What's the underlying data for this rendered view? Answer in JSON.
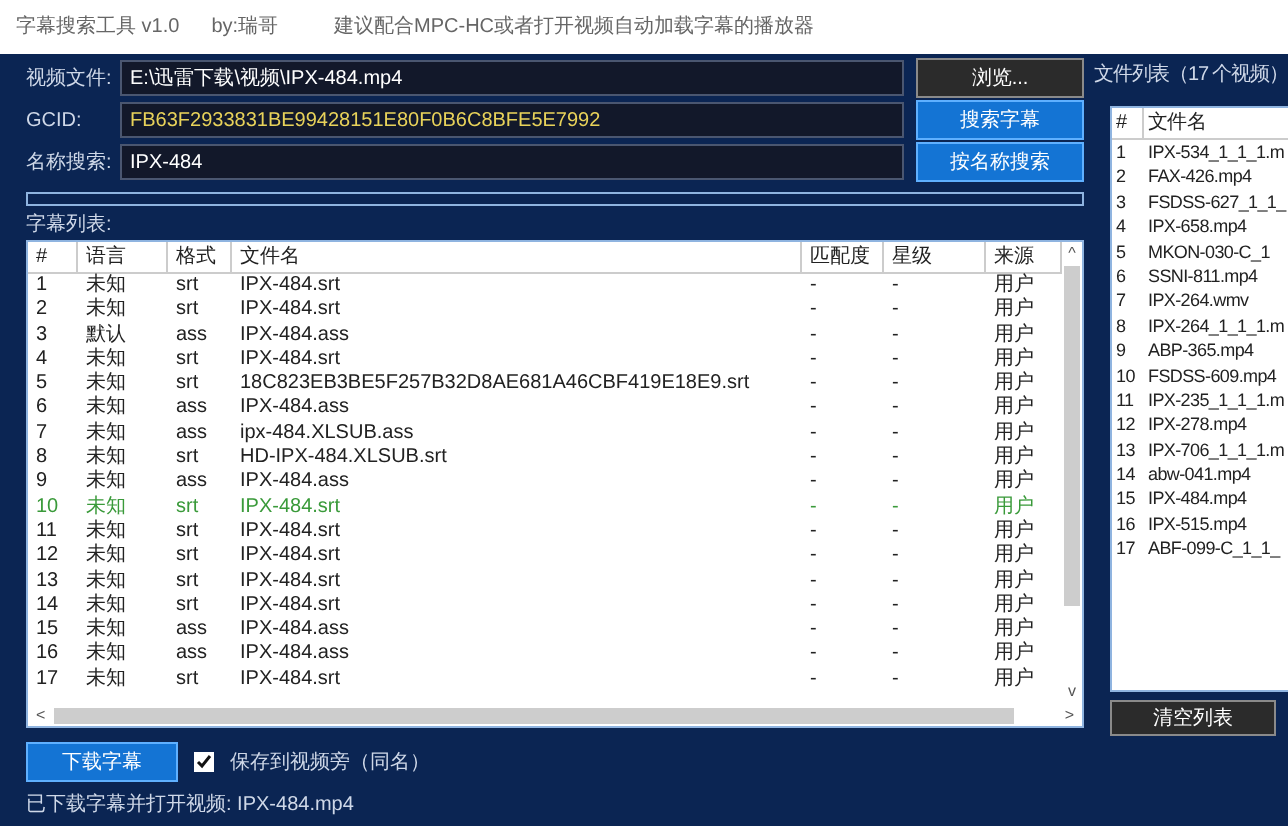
{
  "title_bar": {
    "app_name": "字幕搜索工具 v1.0",
    "author": "by:瑞哥",
    "tip": "建议配合MPC-HC或者打开视频自动加载字幕的播放器"
  },
  "form": [
    {
      "label": "视频文件:",
      "value": "E:\\迅雷下载\\视频\\IPX-484.mp4",
      "kind": "path",
      "button": "浏览..."
    },
    {
      "label": "GCID:",
      "value": "FB63F2933831BE99428151E80F0B6C8BFE5E7992",
      "kind": "hash",
      "button": "搜索字幕"
    },
    {
      "label": "名称搜索:",
      "value": "IPX-484",
      "kind": "name",
      "button": "按名称搜索"
    }
  ],
  "progress": {
    "level": 0
  },
  "subtitle_list": {
    "label": "字幕列表:",
    "columns": [
      "#",
      "语言",
      "格式",
      "文件名",
      "匹配度",
      "星级",
      "来源"
    ],
    "rows": [
      {
        "cells": [
          "1",
          "未知",
          "srt",
          "IPX-484.srt",
          "-",
          "-",
          "用户"
        ],
        "downloaded": false
      },
      {
        "cells": [
          "2",
          "未知",
          "srt",
          "IPX-484.srt",
          "-",
          "-",
          "用户"
        ],
        "downloaded": false
      },
      {
        "cells": [
          "3",
          "默认",
          "ass",
          "IPX-484.ass",
          "-",
          "-",
          "用户"
        ],
        "downloaded": false
      },
      {
        "cells": [
          "4",
          "未知",
          "srt",
          "IPX-484.srt",
          "-",
          "-",
          "用户"
        ],
        "downloaded": false
      },
      {
        "cells": [
          "5",
          "未知",
          "srt",
          "18C823EB3BE5F257B32D8AE681A46CBF419E18E9.srt",
          "-",
          "-",
          "用户"
        ],
        "downloaded": false
      },
      {
        "cells": [
          "6",
          "未知",
          "ass",
          "IPX-484.ass",
          "-",
          "-",
          "用户"
        ],
        "downloaded": false
      },
      {
        "cells": [
          "7",
          "未知",
          "ass",
          "ipx-484.XLSUB.ass",
          "-",
          "-",
          "用户"
        ],
        "downloaded": false
      },
      {
        "cells": [
          "8",
          "未知",
          "srt",
          "HD-IPX-484.XLSUB.srt",
          "-",
          "-",
          "用户"
        ],
        "downloaded": false
      },
      {
        "cells": [
          "9",
          "未知",
          "ass",
          "IPX-484.ass",
          "-",
          "-",
          "用户"
        ],
        "downloaded": false
      },
      {
        "cells": [
          "10",
          "未知",
          "srt",
          "IPX-484.srt",
          "-",
          "-",
          "用户"
        ],
        "downloaded": true
      },
      {
        "cells": [
          "11",
          "未知",
          "srt",
          "IPX-484.srt",
          "-",
          "-",
          "用户"
        ],
        "downloaded": false
      },
      {
        "cells": [
          "12",
          "未知",
          "srt",
          "IPX-484.srt",
          "-",
          "-",
          "用户"
        ],
        "downloaded": false
      },
      {
        "cells": [
          "13",
          "未知",
          "srt",
          "IPX-484.srt",
          "-",
          "-",
          "用户"
        ],
        "downloaded": false
      },
      {
        "cells": [
          "14",
          "未知",
          "srt",
          "IPX-484.srt",
          "-",
          "-",
          "用户"
        ],
        "downloaded": false
      },
      {
        "cells": [
          "15",
          "未知",
          "ass",
          "IPX-484.ass",
          "-",
          "-",
          "用户"
        ],
        "downloaded": false
      },
      {
        "cells": [
          "16",
          "未知",
          "ass",
          "IPX-484.ass",
          "-",
          "-",
          "用户"
        ],
        "downloaded": false
      },
      {
        "cells": [
          "17",
          "未知",
          "srt",
          "IPX-484.srt",
          "-",
          "-",
          "用户"
        ],
        "downloaded": false
      }
    ],
    "scroll_left": "<",
    "scroll_right": ">",
    "scroll_up": "^",
    "scroll_down": "v"
  },
  "download_button": "下载字幕",
  "save_option": {
    "label": "保存到视频旁（同名）",
    "checked": true
  },
  "status": "已下载字幕并打开视频: IPX-484.mp4",
  "file_list": {
    "title": "文件列表（17 个视频）",
    "columns": [
      "#",
      "文件名"
    ],
    "rows": [
      [
        "1",
        "IPX-534_1_1_1.m"
      ],
      [
        "2",
        "FAX-426.mp4"
      ],
      [
        "3",
        "FSDSS-627_1_1_"
      ],
      [
        "4",
        "IPX-658.mp4"
      ],
      [
        "5",
        "MKON-030-C_1"
      ],
      [
        "6",
        "SSNI-811.mp4"
      ],
      [
        "7",
        "IPX-264.wmv"
      ],
      [
        "8",
        "IPX-264_1_1_1.m"
      ],
      [
        "9",
        "ABP-365.mp4"
      ],
      [
        "10",
        "FSDSS-609.mp4"
      ],
      [
        "11",
        "IPX-235_1_1_1.m"
      ],
      [
        "12",
        "IPX-278.mp4"
      ],
      [
        "13",
        "IPX-706_1_1_1.m"
      ],
      [
        "14",
        "abw-041.mp4"
      ],
      [
        "15",
        "IPX-484.mp4"
      ],
      [
        "16",
        "IPX-515.mp4"
      ],
      [
        "17",
        "ABF-099-C_1_1_"
      ]
    ],
    "clear_button": "清空列表"
  }
}
